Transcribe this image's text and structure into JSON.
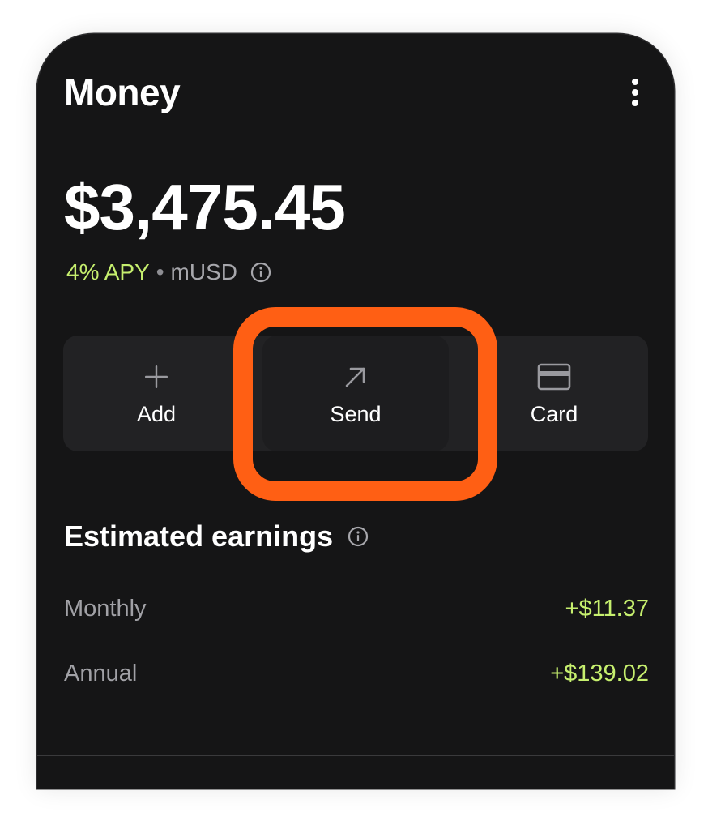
{
  "header": {
    "title": "Money",
    "menu_icon": "more-vertical-icon"
  },
  "balance": {
    "amount": "$3,475.45",
    "apy": "4% APY",
    "separator": "•",
    "token": "mUSD",
    "info_icon": "info-icon"
  },
  "actions": [
    {
      "label": "Add",
      "icon": "plus-icon"
    },
    {
      "label": "Send",
      "icon": "arrow-up-right-icon",
      "highlighted": true
    },
    {
      "label": "Card",
      "icon": "credit-card-icon"
    }
  ],
  "earnings": {
    "title": "Estimated earnings",
    "info_icon": "info-icon",
    "rows": [
      {
        "label": "Monthly",
        "value": "+$11.37"
      },
      {
        "label": "Annual",
        "value": "+$139.02"
      }
    ]
  },
  "colors": {
    "background": "#151516",
    "surface": "#222224",
    "accent_green": "#c6ef6e",
    "highlight_orange": "#ff5f14",
    "text_primary": "#ffffff",
    "text_secondary": "#a1a1a6"
  }
}
